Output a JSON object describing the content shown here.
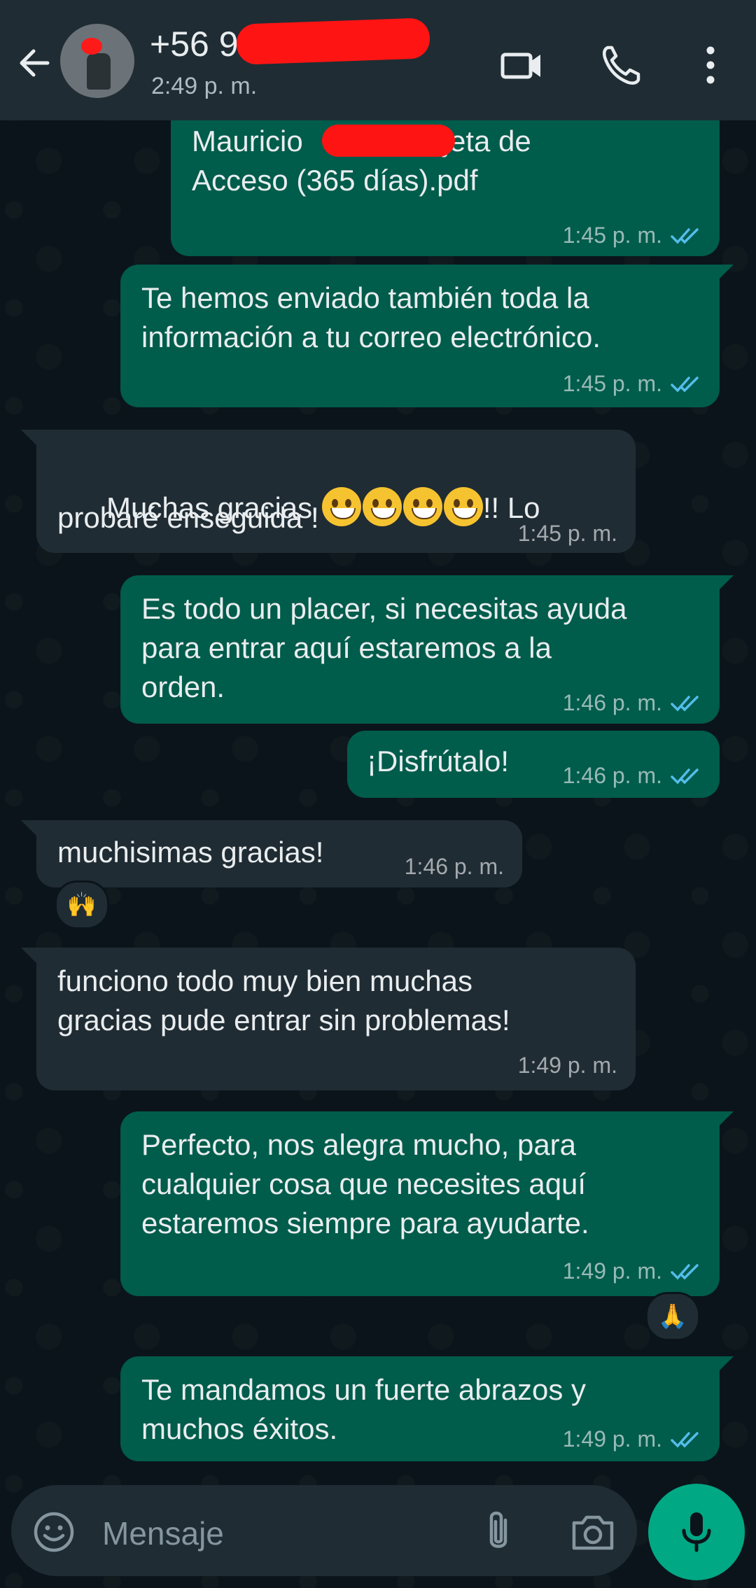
{
  "header": {
    "contact_name": "+56 9",
    "status": "2:49 p. m."
  },
  "input": {
    "placeholder": "Mensaje"
  },
  "messages": [
    {
      "text": "Mauricio          - Tarjeta de\nAcceso (365 días).pdf",
      "time": "1:45 p. m."
    },
    {
      "text": "Te hemos enviado también toda la\ninformación a tu correo electrónico.",
      "time": "1:45 p. m."
    },
    {
      "text_before": "Muchas gracias ",
      "text_after": "!! Lo",
      "text_line2": "probaré enseguida !",
      "time": "1:45 p. m."
    },
    {
      "text": "Es todo un placer, si necesitas ayuda\npara entrar aquí estaremos a la\norden.",
      "time": "1:46 p. m."
    },
    {
      "text": "¡Disfrútalo!",
      "time": "1:46 p. m."
    },
    {
      "text": "muchisimas gracias!",
      "time": "1:46 p. m.",
      "reaction": "🙌"
    },
    {
      "text": "funciono todo muy bien muchas\ngracias pude entrar sin problemas!",
      "time": "1:49 p. m."
    },
    {
      "text": "Perfecto, nos alegra mucho, para\ncualquier cosa que necesites aquí\nestaremos siempre para ayudarte.",
      "time": "1:49 p. m.",
      "reaction": "🙏"
    },
    {
      "text": "Te mandamos un fuerte abrazos y\nmuchos éxitos.",
      "time": "1:49 p. m."
    }
  ],
  "colors": {
    "outgoing_bubble": "#005c4b",
    "incoming_bubble": "#202c33",
    "header": "#1f2c33",
    "accent": "#00a884",
    "tick_read": "#53bdeb"
  },
  "icons": [
    "back-arrow-icon",
    "video-call-icon",
    "phone-icon",
    "more-vert-icon",
    "emoji-icon",
    "attach-icon",
    "camera-icon",
    "mic-icon",
    "double-check-icon"
  ]
}
